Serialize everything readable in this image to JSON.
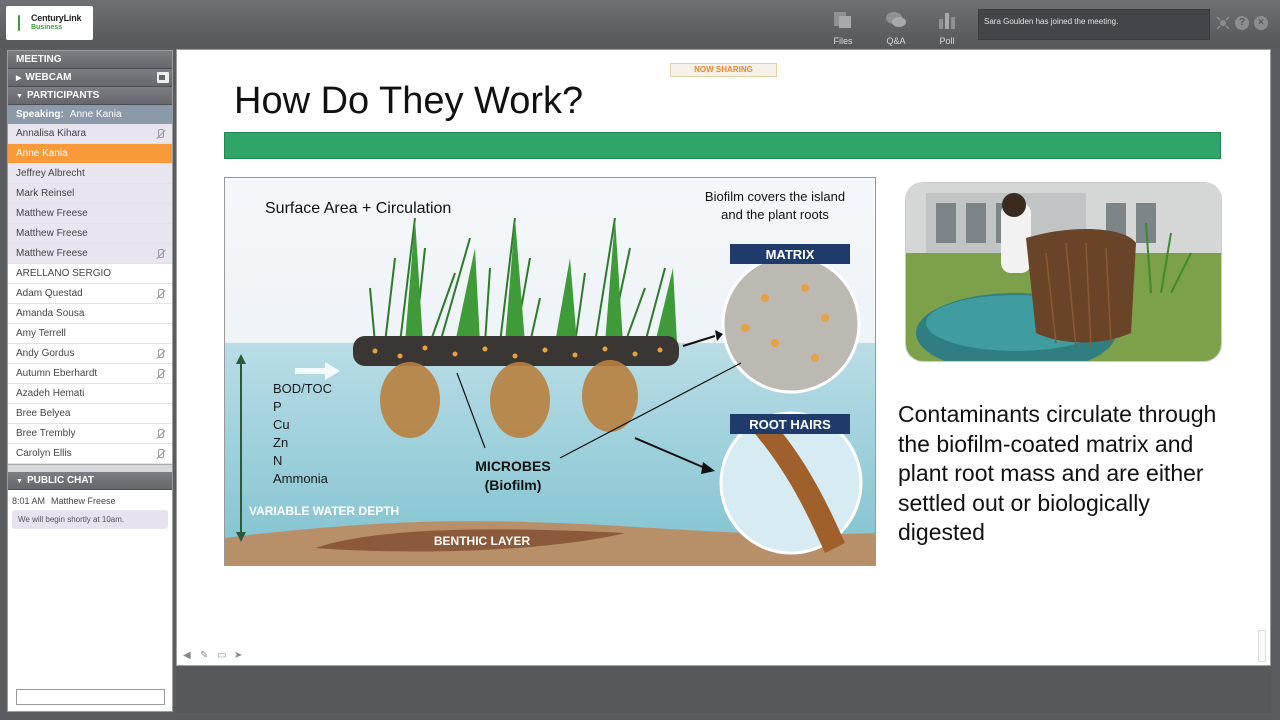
{
  "app": {
    "logo_name": "CenturyLink",
    "logo_sub": "Business"
  },
  "toolbar": {
    "files_label": "Files",
    "qa_label": "Q&A",
    "poll_label": "Poll",
    "notification": "Sara Goulden has joined the meeting.",
    "help_label": "?",
    "close_label": "×"
  },
  "sidebar": {
    "meeting_label": "MEETING",
    "webcam_label": "WEBCAM",
    "participants_label": "PARTICIPANTS",
    "speaking_label": "Speaking:",
    "speaking_name": "Anne Kania",
    "participants": [
      {
        "name": "Annalisa Kihara",
        "muted": true
      },
      {
        "name": "Anne Kania",
        "muted": false
      },
      {
        "name": "Jeffrey Albrecht",
        "muted": false
      },
      {
        "name": "Mark Reinsel",
        "muted": false
      },
      {
        "name": "Matthew Freese",
        "muted": false
      },
      {
        "name": "Matthew Freese",
        "muted": false
      },
      {
        "name": "Matthew Freese",
        "muted": true
      },
      {
        "name": "ARELLANO SERGIO",
        "muted": false
      },
      {
        "name": "Adam Questad",
        "muted": true
      },
      {
        "name": "Amanda Sousa",
        "muted": false
      },
      {
        "name": "Amy Terrell",
        "muted": false
      },
      {
        "name": "Andy Gordus",
        "muted": true
      },
      {
        "name": "Autumn Eberhardt",
        "muted": true
      },
      {
        "name": "Azadeh Hemati",
        "muted": false
      },
      {
        "name": "Bree Belyea",
        "muted": false
      },
      {
        "name": "Bree Trembly",
        "muted": true
      },
      {
        "name": "Carolyn Ellis",
        "muted": true
      }
    ],
    "chat_label": "PUBLIC CHAT",
    "chat": {
      "time": "8:01 AM",
      "author": "Matthew Freese",
      "message": "We will begin shortly at 10am."
    }
  },
  "stage": {
    "now_sharing": "NOW SHARING",
    "slide": {
      "title": "How Do They Work?",
      "body": "Contaminants circulate through the biofilm-coated matrix and plant root mass and are either settled out or biologically digested",
      "diagram": {
        "heading": "Surface Area + Circulation",
        "biofilm_note_1": "Biofilm covers the island",
        "biofilm_note_2": "and the plant roots",
        "matrix_label": "MATRIX",
        "root_hairs_label": "ROOT HAIRS",
        "contaminants": [
          "BOD/TOC",
          "P",
          "Cu",
          "Zn",
          "N",
          "Ammonia"
        ],
        "microbes_1": "MICROBES",
        "microbes_2": "(Biofilm)",
        "depth_label": "VARIABLE WATER DEPTH",
        "benthic_label": "BENTHIC LAYER"
      }
    }
  },
  "colors": {
    "accent_orange": "#f99a3a",
    "slide_green": "#2fa56a",
    "label_navy": "#1f3b6b"
  }
}
